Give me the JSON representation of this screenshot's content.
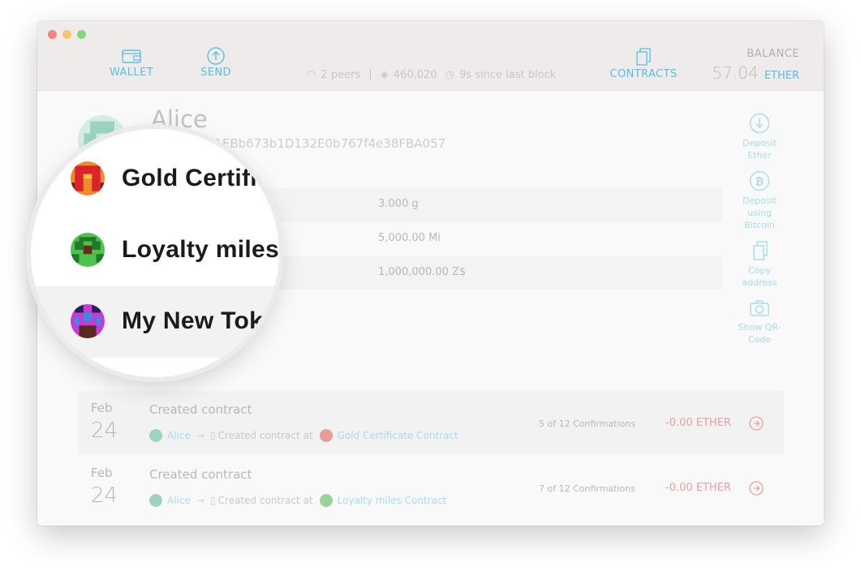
{
  "nav": {
    "wallet_label": "WALLET",
    "send_label": "SEND",
    "contracts_label": "CONTRACTS"
  },
  "status": {
    "peers": "2 peers",
    "separator": "|",
    "block": "460,020",
    "since_block": "9s since last block"
  },
  "balance": {
    "label": "BALANCE",
    "value": "57.04",
    "unit": "ETHER"
  },
  "account": {
    "name": "Alice",
    "address": "0974d8D61EBb673b1D132E0b767f4e38FBA057"
  },
  "tokens": [
    {
      "name": "Gold Certifi",
      "amount": "3.000 g"
    },
    {
      "name": "Loyalty miles",
      "amount": "5,000.00 Mi"
    },
    {
      "name": "My New Tok",
      "amount": "1,000,000.00 Z$"
    }
  ],
  "side_actions": [
    {
      "label_1": "Deposit",
      "label_2": "Ether",
      "icon": "arrow-down-circle-icon"
    },
    {
      "label_1": "Deposit",
      "label_2": "using",
      "label_3": "Bitcoin",
      "icon": "bitcoin-icon"
    },
    {
      "label_1": "Copy",
      "label_2": "address",
      "icon": "copy-icon"
    },
    {
      "label_1": "Show QR-",
      "label_2": "Code",
      "icon": "camera-icon"
    }
  ],
  "transactions": [
    {
      "month": "Feb",
      "day": "24",
      "title": "Created contract",
      "from": "Alice",
      "action": "Created contract at",
      "target": "Gold Certificate Contract",
      "confirmations": "5 of 12 Confirmations",
      "amount": "-0.00 ETHER"
    },
    {
      "month": "Feb",
      "day": "24",
      "title": "Created contract",
      "from": "Alice",
      "action": "Created contract at",
      "target": "Loyalty miles Contract",
      "confirmations": "7 of 12 Confirmations",
      "amount": "-0.00 ETHER"
    }
  ],
  "colors": {
    "accent": "#55c0e0",
    "negative": "#e2434a",
    "titlebar": "#eeebea"
  }
}
